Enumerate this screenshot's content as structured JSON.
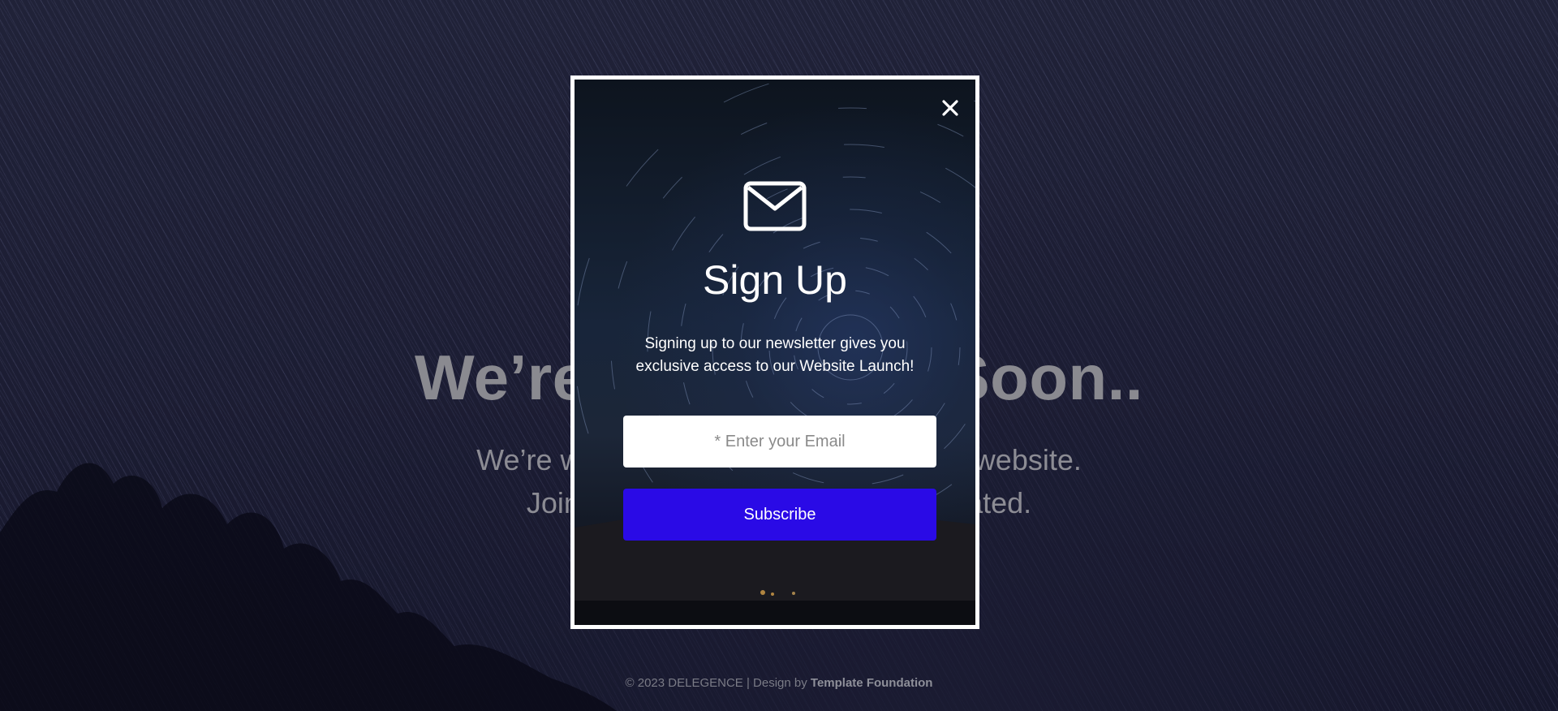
{
  "hero": {
    "title": "We’re Launching Soon..",
    "subtitle_line1": "We’re working hard to launch our new website.",
    "subtitle_line2": "Join our newsletter list to stay updated."
  },
  "footer": {
    "copyright": "© 2023 DELEGENCE | Design by ",
    "credit": "Template Foundation"
  },
  "modal": {
    "close_icon": "close-icon",
    "envelope_icon": "envelope-icon",
    "title": "Sign Up",
    "description_line1": "Signing up to our newsletter gives you",
    "description_line2": "exclusive access to our Website Launch!",
    "email_placeholder": "* Enter your Email",
    "email_value": "",
    "subscribe_label": "Subscribe",
    "accent_color": "#2a0ae6"
  }
}
